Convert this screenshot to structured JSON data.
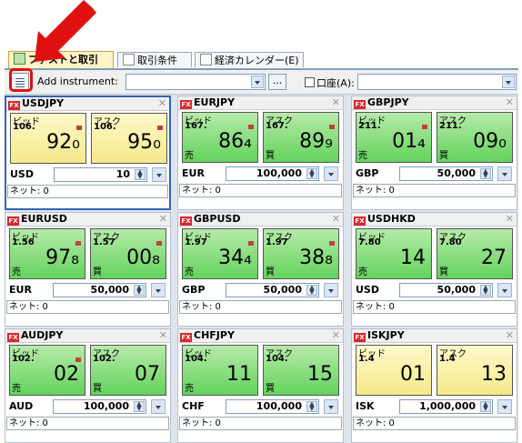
{
  "tabs": [
    {
      "label": "ファストと取引",
      "active": true
    },
    {
      "label": "取引条件",
      "active": false
    },
    {
      "label": "経済カレンダー(E)",
      "active": false
    }
  ],
  "toolbar": {
    "add_instrument_label": "Add instrument:",
    "instrument_value": "",
    "more_button": "...",
    "account_label": "口座(A):",
    "account_value": ""
  },
  "panels": [
    {
      "pair": "USDJPY",
      "selected": true,
      "bid": {
        "label": "ビッド",
        "big": "106.",
        "pips": "92₀",
        "side": "",
        "color": "yellow",
        "flag": true
      },
      "ask": {
        "label": "アスク",
        "big": "106.",
        "pips": "95₀",
        "side": "",
        "color": "yellow",
        "flag": true
      },
      "ccy": "USD",
      "amount": "10",
      "net": "ネット: 0"
    },
    {
      "pair": "EURJPY",
      "selected": false,
      "bid": {
        "label": "ビッド",
        "big": "167.",
        "pips": "86₄",
        "side": "売",
        "color": "green",
        "flag": true
      },
      "ask": {
        "label": "アスク",
        "big": "167.",
        "pips": "89₉",
        "side": "買",
        "color": "green",
        "flag": true
      },
      "ccy": "EUR",
      "amount": "100,000",
      "net": "ネット: 0"
    },
    {
      "pair": "GBPJPY",
      "selected": false,
      "bid": {
        "label": "ビッド",
        "big": "211.",
        "pips": "01₄",
        "side": "売",
        "color": "green",
        "flag": true
      },
      "ask": {
        "label": "アスク",
        "big": "211.",
        "pips": "09₀",
        "side": "買",
        "color": "green",
        "flag": false
      },
      "ccy": "GBP",
      "amount": "50,000",
      "net": "ネット: 0"
    },
    {
      "pair": "EURUSD",
      "selected": false,
      "bid": {
        "label": "ビッド",
        "big": "1.56",
        "pips": "97₈",
        "side": "売",
        "color": "green",
        "flag": true
      },
      "ask": {
        "label": "アスク",
        "big": "1.57",
        "pips": "00₈",
        "side": "買",
        "color": "green",
        "flag": true
      },
      "ccy": "EUR",
      "amount": "50,000",
      "net": "ネット: 0"
    },
    {
      "pair": "GBPUSD",
      "selected": false,
      "bid": {
        "label": "ビッド",
        "big": "1.97",
        "pips": "34₄",
        "side": "売",
        "color": "green",
        "flag": true
      },
      "ask": {
        "label": "アスク",
        "big": "1.97",
        "pips": "38₈",
        "side": "買",
        "color": "green",
        "flag": true
      },
      "ccy": "GBP",
      "amount": "50,000",
      "net": "ネット: 0"
    },
    {
      "pair": "USDHKD",
      "selected": false,
      "bid": {
        "label": "ビッド",
        "big": "7.80",
        "pips": "14",
        "side": "売",
        "color": "green",
        "flag": false
      },
      "ask": {
        "label": "アスク",
        "big": "7.80",
        "pips": "27",
        "side": "買",
        "color": "green",
        "flag": false
      },
      "ccy": "USD",
      "amount": "50,000",
      "net": "ネット: 0"
    },
    {
      "pair": "AUDJPY",
      "selected": false,
      "bid": {
        "label": "ビッド",
        "big": "102.",
        "pips": "02",
        "side": "売",
        "color": "green",
        "flag": true
      },
      "ask": {
        "label": "アスク",
        "big": "102.",
        "pips": "07",
        "side": "買",
        "color": "green",
        "flag": false
      },
      "ccy": "AUD",
      "amount": "100,000",
      "net": "ネット: 0"
    },
    {
      "pair": "CHFJPY",
      "selected": false,
      "bid": {
        "label": "ビッド",
        "big": "104.",
        "pips": "11",
        "side": "売",
        "color": "green",
        "flag": false
      },
      "ask": {
        "label": "アスク",
        "big": "104.",
        "pips": "15",
        "side": "買",
        "color": "green",
        "flag": false
      },
      "ccy": "CHF",
      "amount": "100,000",
      "net": "ネット: 0"
    },
    {
      "pair": "ISKJPY",
      "selected": false,
      "bid": {
        "label": "ビッド",
        "big": "1.4",
        "pips": "01",
        "side": "",
        "color": "yellow",
        "flag": false
      },
      "ask": {
        "label": "アスク",
        "big": "1.4",
        "pips": "13",
        "side": "",
        "color": "yellow",
        "flag": false
      },
      "ccy": "ISK",
      "amount": "1,000,000",
      "net": "ネット: 0"
    }
  ],
  "colors": {
    "highlight": "#e01010",
    "selected_border": "#3463b5",
    "green": "#63d35c",
    "yellow": "#f5e98a"
  }
}
